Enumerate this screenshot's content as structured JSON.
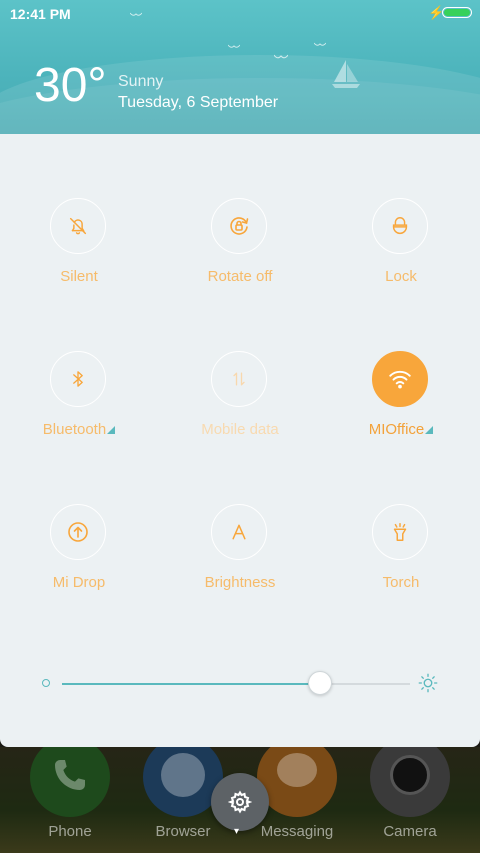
{
  "status_bar": {
    "time": "12:41 PM",
    "charging_icon": "bolt-icon",
    "battery_color": "#37d15b"
  },
  "weather": {
    "temperature": "30°",
    "condition": "Sunny",
    "date": "Tuesday, 6 September"
  },
  "tiles": [
    {
      "label": "Silent",
      "icon": "bell-off-icon",
      "state": "off"
    },
    {
      "label": "Rotate off",
      "icon": "rotate-lock-icon",
      "state": "off"
    },
    {
      "label": "Lock",
      "icon": "lock-icon",
      "state": "off"
    },
    {
      "label": "Bluetooth",
      "icon": "bluetooth-icon",
      "state": "off"
    },
    {
      "label": "Mobile data",
      "icon": "mobile-data-icon",
      "state": "disabled"
    },
    {
      "label": "MIOffice",
      "icon": "wifi-icon",
      "state": "on"
    },
    {
      "label": "Mi Drop",
      "icon": "mi-drop-icon",
      "state": "off"
    },
    {
      "label": "Brightness",
      "icon": "brightness-auto-icon",
      "state": "off"
    },
    {
      "label": "Torch",
      "icon": "torch-icon",
      "state": "off"
    }
  ],
  "brightness_slider": {
    "level_fraction": 0.74
  },
  "dock": {
    "apps": [
      {
        "label": "Phone",
        "icon": "phone-icon"
      },
      {
        "label": "Browser",
        "icon": "browser-icon"
      },
      {
        "label": "Messaging",
        "icon": "messaging-icon"
      },
      {
        "label": "Camera",
        "icon": "camera-icon"
      }
    ]
  },
  "colors": {
    "accent": "#f8a63b",
    "label": "#f6bb6a",
    "teal": "#5ab9bd",
    "panel": "#ecf1f3"
  }
}
